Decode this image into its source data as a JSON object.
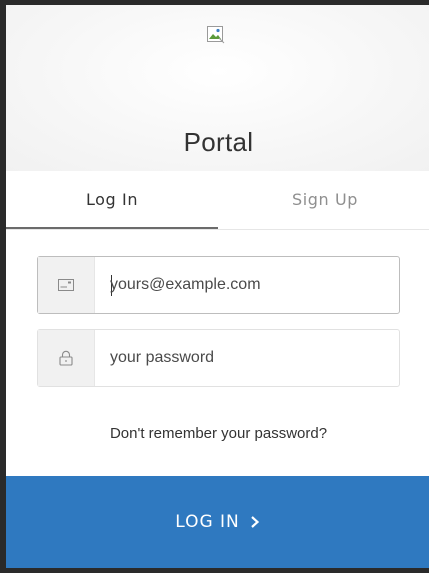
{
  "header": {
    "logo_icon": "broken-image-icon",
    "title": "Portal"
  },
  "tabs": [
    {
      "label": "Log In",
      "active": true
    },
    {
      "label": "Sign Up",
      "active": false
    }
  ],
  "form": {
    "email": {
      "icon": "envelope-icon",
      "value": "",
      "placeholder": "yours@example.com"
    },
    "password": {
      "icon": "lock-icon",
      "value": "",
      "placeholder": "your password"
    },
    "forgot_label": "Don't remember your password?"
  },
  "submit": {
    "label": "LOG IN",
    "icon": "chevron-right-icon",
    "color": "#2f79c0"
  }
}
